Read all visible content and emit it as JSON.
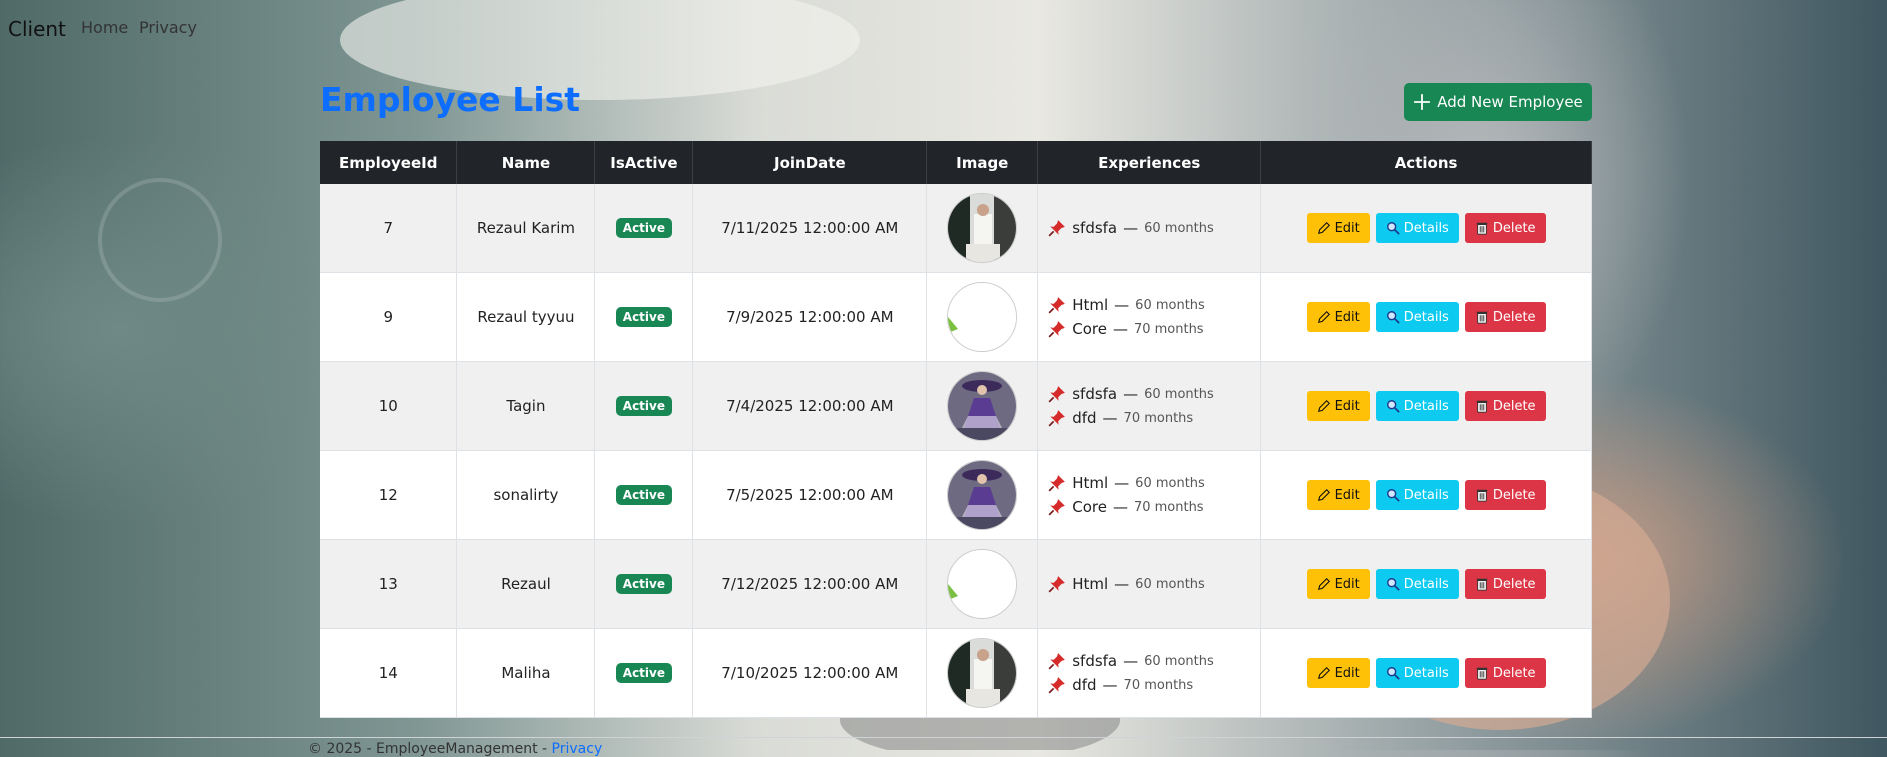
{
  "navbar": {
    "brand": "Client",
    "links": [
      "Home",
      "Privacy"
    ]
  },
  "page": {
    "title": "Employee List",
    "add_button_label": "Add New Employee"
  },
  "table": {
    "headers": [
      "EmployeeId",
      "Name",
      "IsActive",
      "JoinDate",
      "Image",
      "Experiences",
      "Actions"
    ],
    "rows": [
      {
        "id": "7",
        "name": "Rezaul Karim",
        "status": "Active",
        "join_date": "7/11/2025 12:00:00 AM",
        "image": "photo-desk",
        "experiences": [
          {
            "title": "sfdsfa",
            "sep": "—",
            "months": "60 months"
          }
        ]
      },
      {
        "id": "9",
        "name": "Rezaul tyyuu",
        "status": "Active",
        "join_date": "7/9/2025 12:00:00 AM",
        "image": "blank-green",
        "experiences": [
          {
            "title": "Html",
            "sep": "—",
            "months": "60 months"
          },
          {
            "title": "Core",
            "sep": "—",
            "months": "70 months"
          }
        ]
      },
      {
        "id": "10",
        "name": "Tagin",
        "status": "Active",
        "join_date": "7/4/2025 12:00:00 AM",
        "image": "photo-purple-dress",
        "experiences": [
          {
            "title": "sfdsfa",
            "sep": "—",
            "months": "60 months"
          },
          {
            "title": "dfd",
            "sep": "—",
            "months": "70 months"
          }
        ]
      },
      {
        "id": "12",
        "name": "sonalirty",
        "status": "Active",
        "join_date": "7/5/2025 12:00:00 AM",
        "image": "photo-purple-dress",
        "experiences": [
          {
            "title": "Html",
            "sep": "—",
            "months": "60 months"
          },
          {
            "title": "Core",
            "sep": "—",
            "months": "70 months"
          }
        ]
      },
      {
        "id": "13",
        "name": "Rezaul",
        "status": "Active",
        "join_date": "7/12/2025 12:00:00 AM",
        "image": "blank-green",
        "experiences": [
          {
            "title": "Html",
            "sep": "—",
            "months": "60 months"
          }
        ]
      },
      {
        "id": "14",
        "name": "Maliha",
        "status": "Active",
        "join_date": "7/10/2025 12:00:00 AM",
        "image": "photo-desk",
        "experiences": [
          {
            "title": "sfdsfa",
            "sep": "—",
            "months": "60 months"
          },
          {
            "title": "dfd",
            "sep": "—",
            "months": "70 months"
          }
        ]
      }
    ]
  },
  "actions": {
    "edit": "Edit",
    "details": "Details",
    "delete": "Delete"
  },
  "footer": {
    "text": "© 2025 - EmployeeManagement -",
    "link": "Privacy"
  },
  "colors": {
    "primary": "#0d6efd",
    "success": "#198754",
    "warning": "#ffc107",
    "info": "#0dcaf0",
    "danger": "#dc3545",
    "header": "#212529"
  },
  "icons": {
    "add": "plus-icon",
    "edit": "pencil-icon",
    "details": "magnifier-icon",
    "delete": "trash-icon",
    "experience": "pushpin-icon"
  }
}
